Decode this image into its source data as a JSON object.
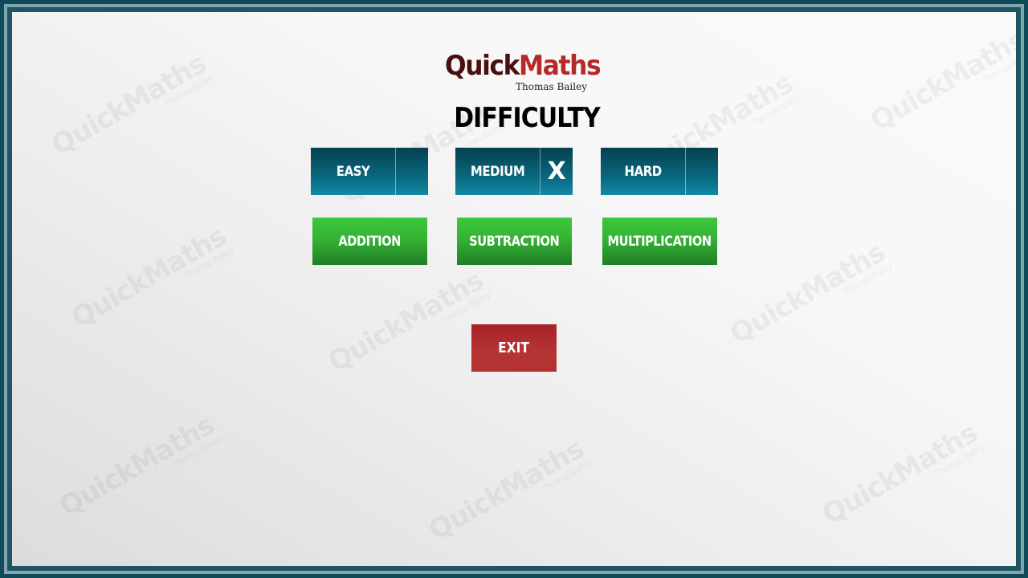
{
  "logo": {
    "part1": "Quick",
    "part2": "Maths",
    "author": "Thomas Bailey"
  },
  "heading": "DIFFICULTY",
  "difficulty": [
    {
      "label": "EASY",
      "mark": ""
    },
    {
      "label": "MEDIUM",
      "mark": "X"
    },
    {
      "label": "HARD",
      "mark": ""
    }
  ],
  "selected_difficulty": "MEDIUM",
  "operations": [
    "ADDITION",
    "SUBTRACTION",
    "MULTIPLICATION"
  ],
  "exit_label": "EXIT",
  "watermark": {
    "title": "QuickMaths",
    "author": "Thomas Bailey"
  },
  "colors": {
    "difficulty_button": "#0a6a82",
    "operation_button": "#35b235",
    "exit_button": "#b23030",
    "logo_dark": "#4a0f0f",
    "logo_red": "#b42a2a"
  }
}
